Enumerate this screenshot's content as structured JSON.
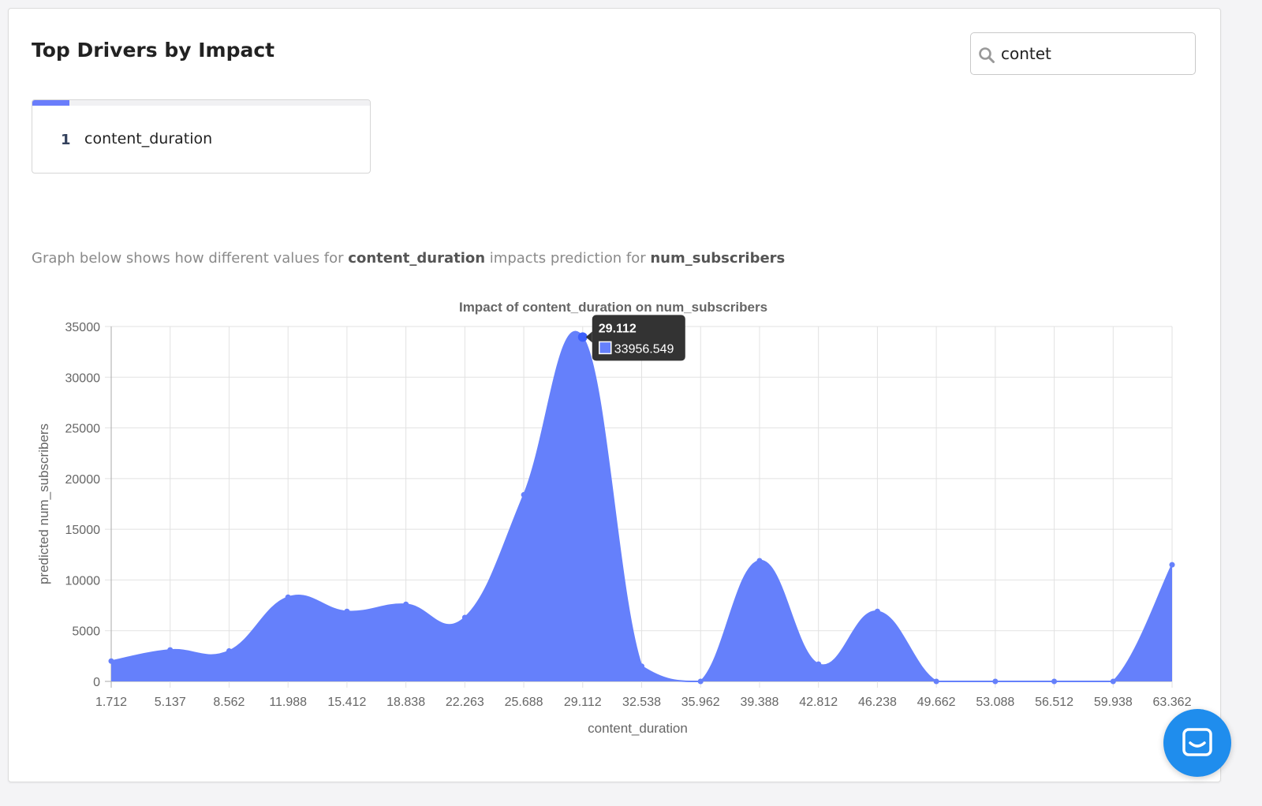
{
  "header": {
    "title": "Top Drivers by Impact"
  },
  "search": {
    "value": "contet"
  },
  "drivers": [
    {
      "rank": "1",
      "name": "content_duration",
      "impact": 0.11
    }
  ],
  "caption": {
    "prefix": "Graph below shows how different values for ",
    "feature": "content_duration",
    "middle": " impacts prediction for ",
    "target": "num_subscribers"
  },
  "chart_data": {
    "type": "area",
    "title": "Impact of content_duration on num_subscribers",
    "xlabel": "content_duration",
    "ylabel": "predicted num_subscribers",
    "x": [
      1.712,
      5.137,
      8.562,
      11.988,
      15.412,
      18.838,
      22.263,
      25.688,
      29.112,
      32.538,
      35.962,
      39.388,
      42.812,
      46.238,
      49.662,
      53.088,
      56.512,
      59.938,
      63.362
    ],
    "y": [
      2000,
      3100,
      3000,
      8300,
      6900,
      7600,
      6300,
      18400,
      33956.549,
      1500,
      0,
      11900,
      1700,
      6900,
      0,
      0,
      0,
      0,
      11500
    ],
    "x_tick_labels": [
      "1.712",
      "5.137",
      "8.562",
      "11.988",
      "15.412",
      "18.838",
      "22.263",
      "25.688",
      "29.112",
      "32.538",
      "35.962",
      "39.388",
      "42.812",
      "46.238",
      "49.662",
      "53.088",
      "56.512",
      "59.938",
      "63.362"
    ],
    "ylim": [
      0,
      35000
    ],
    "y_ticks": [
      "0",
      "5000",
      "10000",
      "15000",
      "20000",
      "25000",
      "30000",
      "35000"
    ],
    "grid": true,
    "color": "#6580fb",
    "tooltip": {
      "index": 8,
      "title": "29.112",
      "value": "33956.549"
    }
  },
  "colors": {
    "accent": "#6580fb",
    "chat": "#1f8ded"
  },
  "icons": {
    "search": "search-icon",
    "chat": "chat-icon"
  }
}
